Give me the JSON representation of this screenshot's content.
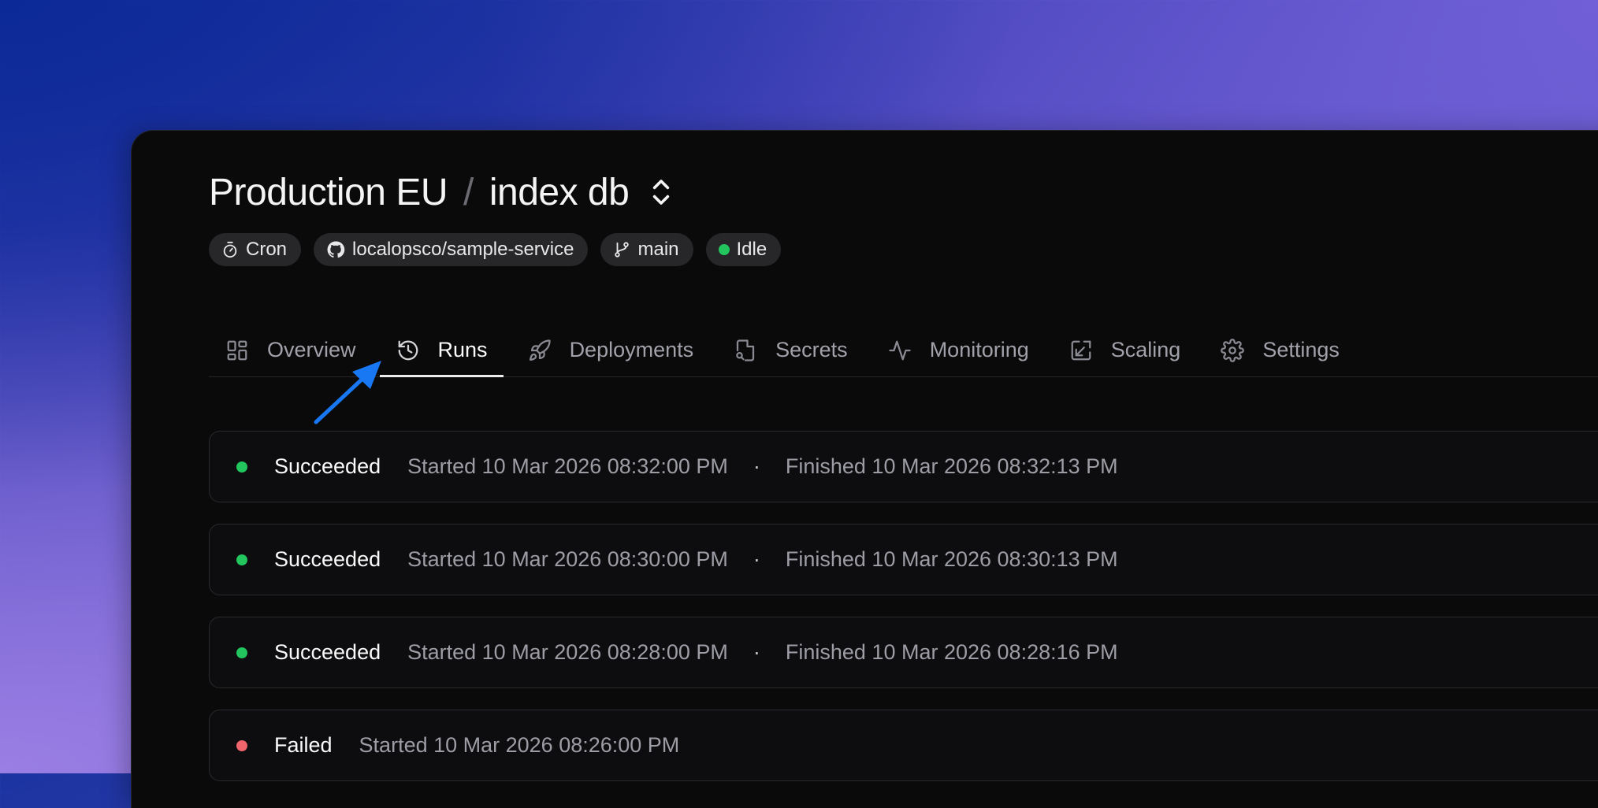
{
  "breadcrumb": {
    "environment": "Production EU",
    "separator": "/",
    "service": "index db"
  },
  "chips": [
    {
      "icon": "timer-icon",
      "label": "Cron"
    },
    {
      "icon": "github-icon",
      "label": "localopsco/sample-service"
    },
    {
      "icon": "git-branch-icon",
      "label": "main"
    },
    {
      "icon": "status-dot-green",
      "label": "Idle"
    }
  ],
  "tabs": [
    {
      "icon": "grid-icon",
      "label": "Overview",
      "active": false
    },
    {
      "icon": "history-icon",
      "label": "Runs",
      "active": true
    },
    {
      "icon": "rocket-icon",
      "label": "Deployments",
      "active": false
    },
    {
      "icon": "file-key-icon",
      "label": "Secrets",
      "active": false
    },
    {
      "icon": "activity-icon",
      "label": "Monitoring",
      "active": false
    },
    {
      "icon": "scale-icon",
      "label": "Scaling",
      "active": false
    },
    {
      "icon": "gear-icon",
      "label": "Settings",
      "active": false
    }
  ],
  "runs": [
    {
      "status": "Succeeded",
      "status_color": "#22c55e",
      "started": "Started 10 Mar 2026 08:32:00 PM",
      "separator": "·",
      "finished": "Finished 10 Mar 2026 08:32:13 PM"
    },
    {
      "status": "Succeeded",
      "status_color": "#22c55e",
      "started": "Started 10 Mar 2026 08:30:00 PM",
      "separator": "·",
      "finished": "Finished 10 Mar 2026 08:30:13 PM"
    },
    {
      "status": "Succeeded",
      "status_color": "#22c55e",
      "started": "Started 10 Mar 2026 08:28:00 PM",
      "separator": "·",
      "finished": "Finished 10 Mar 2026 08:28:16 PM"
    },
    {
      "status": "Failed",
      "status_color": "#f0646b",
      "started": "Started 10 Mar 2026 08:26:00 PM"
    }
  ],
  "colors": {
    "accent_arrow": "#1877f2",
    "success": "#22c55e",
    "failure": "#f0646b"
  }
}
